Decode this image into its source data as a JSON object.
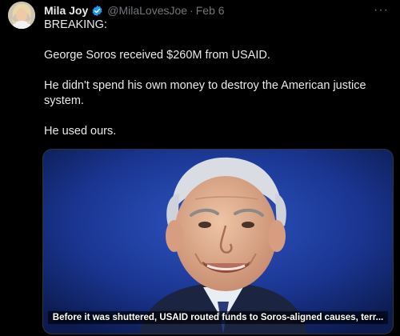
{
  "tweet": {
    "display_name": "Mila Joy",
    "handle": "@MilaLovesJoe",
    "separator": "·",
    "date": "Feb 6",
    "more_label": "···",
    "lines": [
      "BREAKING:",
      "George Soros received $260M from USAID.",
      "He didn't spend his own money to destroy the American justice system.",
      "He used ours."
    ],
    "media": {
      "caption": "Before it was shuttered, USAID routed funds to Soros-aligned causes, terr..."
    }
  },
  "colors": {
    "background": "#000000",
    "text": "#e7e9ea",
    "muted": "#71767b",
    "verified": "#1d9bf0",
    "media_bg": "#14296b"
  },
  "icons": {
    "verified": "verified-badge-icon",
    "more": "more-dots-icon"
  }
}
